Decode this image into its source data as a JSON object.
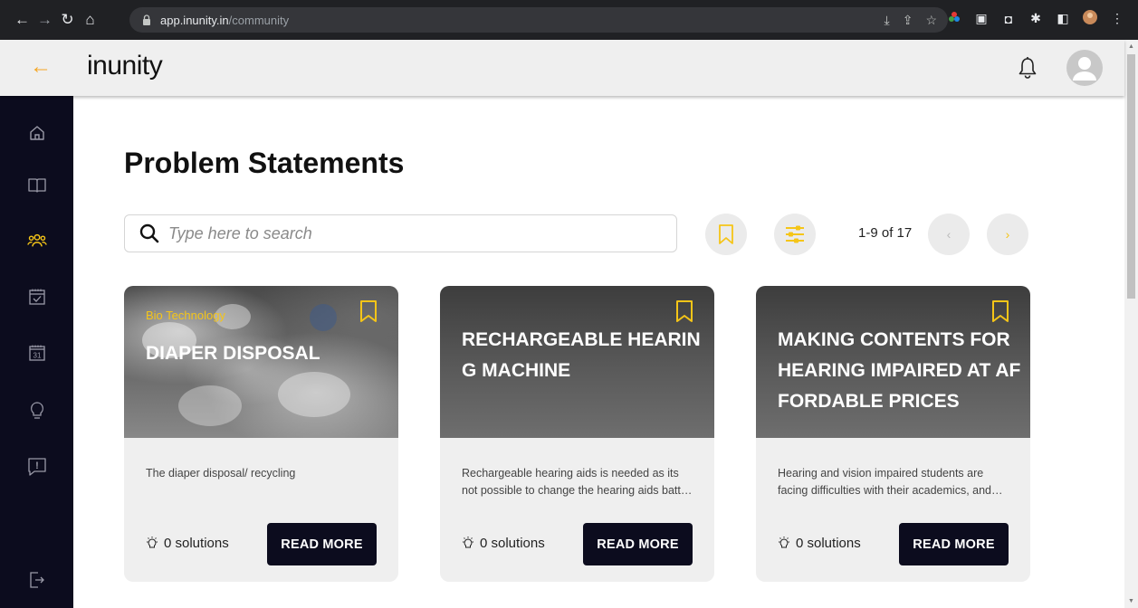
{
  "browser": {
    "url_host": "app.inunity.in",
    "url_path": "/community"
  },
  "header": {
    "brand": "inunity"
  },
  "sidebar": {
    "items": [
      {
        "name": "home",
        "icon": "home-icon"
      },
      {
        "name": "learn",
        "icon": "book-icon"
      },
      {
        "name": "community",
        "icon": "people-icon",
        "active": true
      },
      {
        "name": "tasks",
        "icon": "calendar-check-icon"
      },
      {
        "name": "calendar",
        "icon": "calendar-icon",
        "day": "31"
      },
      {
        "name": "ideas",
        "icon": "bulb-icon"
      },
      {
        "name": "report",
        "icon": "alert-icon",
        "glyph": "!"
      },
      {
        "name": "logout",
        "icon": "logout-icon"
      }
    ]
  },
  "main": {
    "title": "Problem Statements",
    "search_placeholder": "Type here to search",
    "pager": "1-9 of 17",
    "prev": "‹",
    "next": "›"
  },
  "cards": [
    {
      "category": "Bio Technology",
      "title": "DIAPER DISPOSAL",
      "description": "The diaper disposal/ recycling",
      "solutions": "0 solutions",
      "cta": "READ MORE"
    },
    {
      "category": "",
      "title": "RECHARGEABLE HEARING MACHINE",
      "description": "Rechargeable hearing aids is needed as its not possible to change the hearing aids battery again and again",
      "solutions": "0 solutions",
      "cta": "READ MORE"
    },
    {
      "category": "",
      "title": "MAKING CONTENTS FOR HEARING IMPAIRED AT AFFORDABLE PRICES",
      "description": "Hearing and vision impaired students are facing difficulties with their academics, and learning content",
      "solutions": "0 solutions",
      "cta": "READ MORE"
    }
  ],
  "colors": {
    "accent": "#f5c518",
    "back_arrow": "#f5a623",
    "sidebar_bg": "#0c0c1e",
    "button_bg": "#0c0c1e"
  }
}
